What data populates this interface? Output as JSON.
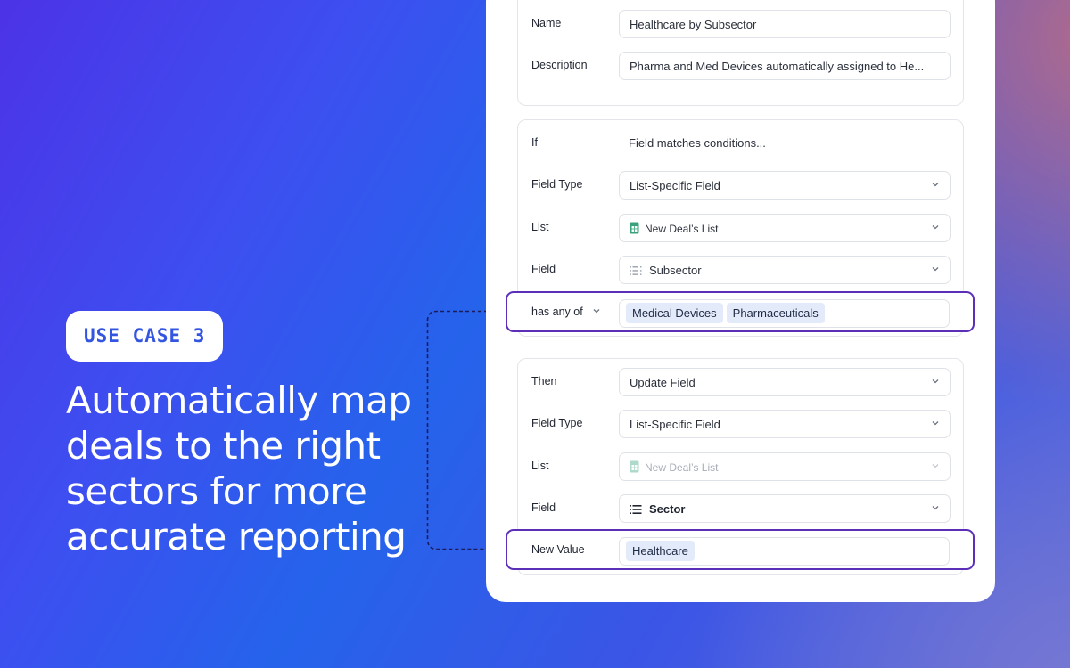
{
  "badge": "USE CASE 3",
  "headline": "Automatically map\ndeals to the right\nsectors for more\naccurate reporting",
  "colors": {
    "highlight_border": "#5b2fb8",
    "tag_bg": "#e3ebfb",
    "badge_text": "#3355e0"
  },
  "details": {
    "name_label": "Name",
    "name_value": "Healthcare by Subsector",
    "description_label": "Description",
    "description_value": "Pharma and Med Devices automatically assigned to He..."
  },
  "condition": {
    "if_label": "If",
    "if_value": "Field matches conditions...",
    "field_type_label": "Field Type",
    "field_type_value": "List-Specific Field",
    "list_label": "List",
    "list_value": "New Deal’s List",
    "field_label": "Field",
    "field_value": "Subsector",
    "operator_label": "has any of",
    "tags": [
      "Medical Devices",
      "Pharmaceuticals"
    ]
  },
  "action": {
    "then_label": "Then",
    "then_value": "Update Field",
    "field_type_label": "Field Type",
    "field_type_value": "List-Specific Field",
    "list_label": "List",
    "list_value": "New Deal’s List",
    "field_label": "Field",
    "field_value": "Sector",
    "new_value_label": "New Value",
    "new_value_tag": "Healthcare"
  },
  "icons": [
    "chevron-down-icon",
    "spreadsheet-icon",
    "list-icon"
  ]
}
